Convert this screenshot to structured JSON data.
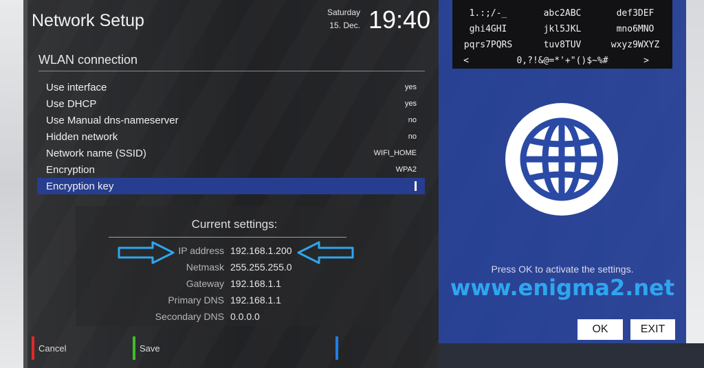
{
  "window": {
    "title": "Network Setup",
    "day": "Saturday",
    "date": "15. Dec.",
    "time": "19:40"
  },
  "section": {
    "title": "WLAN connection"
  },
  "settings": [
    {
      "label": "Use interface",
      "value": "yes"
    },
    {
      "label": "Use DHCP",
      "value": "yes"
    },
    {
      "label": "Use Manual dns-nameserver",
      "value": "no"
    },
    {
      "label": "Hidden network",
      "value": "no"
    },
    {
      "label": "Network name (SSID)",
      "value": "WIFI_HOME"
    },
    {
      "label": "Encryption",
      "value": "WPA2"
    },
    {
      "label": "Encryption key",
      "value": "",
      "selected": true
    }
  ],
  "current": {
    "title": "Current settings:",
    "rows": [
      {
        "key": "IP address",
        "value": "192.168.1.200"
      },
      {
        "key": "Netmask",
        "value": "255.255.255.0"
      },
      {
        "key": "Gateway",
        "value": "192.168.1.1"
      },
      {
        "key": "Primary DNS",
        "value": "192.168.1.1"
      },
      {
        "key": "Secondary DNS",
        "value": "0.0.0.0"
      }
    ]
  },
  "keys": {
    "red": "Cancel",
    "green": "Save",
    "colors": {
      "red": "#e0282a",
      "green": "#3fbf2a",
      "blue": "#1f7fe6"
    }
  },
  "keyboard": {
    "rows": [
      [
        "1.:;/-_",
        "abc2ABC",
        "def3DEF"
      ],
      [
        "ghi4GHI",
        "jkl5JKL",
        "mno6MNO"
      ],
      [
        "pqrs7PQRS",
        "tuv8TUV",
        "wxyz9WXYZ"
      ],
      [
        "<",
        "0,?!&@=*'+\"()$~%#",
        ">"
      ]
    ]
  },
  "right": {
    "hint": "Press OK to activate the settings.",
    "site": "www.enigma2.net",
    "ok_label": "OK",
    "exit_label": "EXIT",
    "icon": "globe-icon"
  },
  "annotations": {
    "arrow_color": "#2ea6ef"
  }
}
